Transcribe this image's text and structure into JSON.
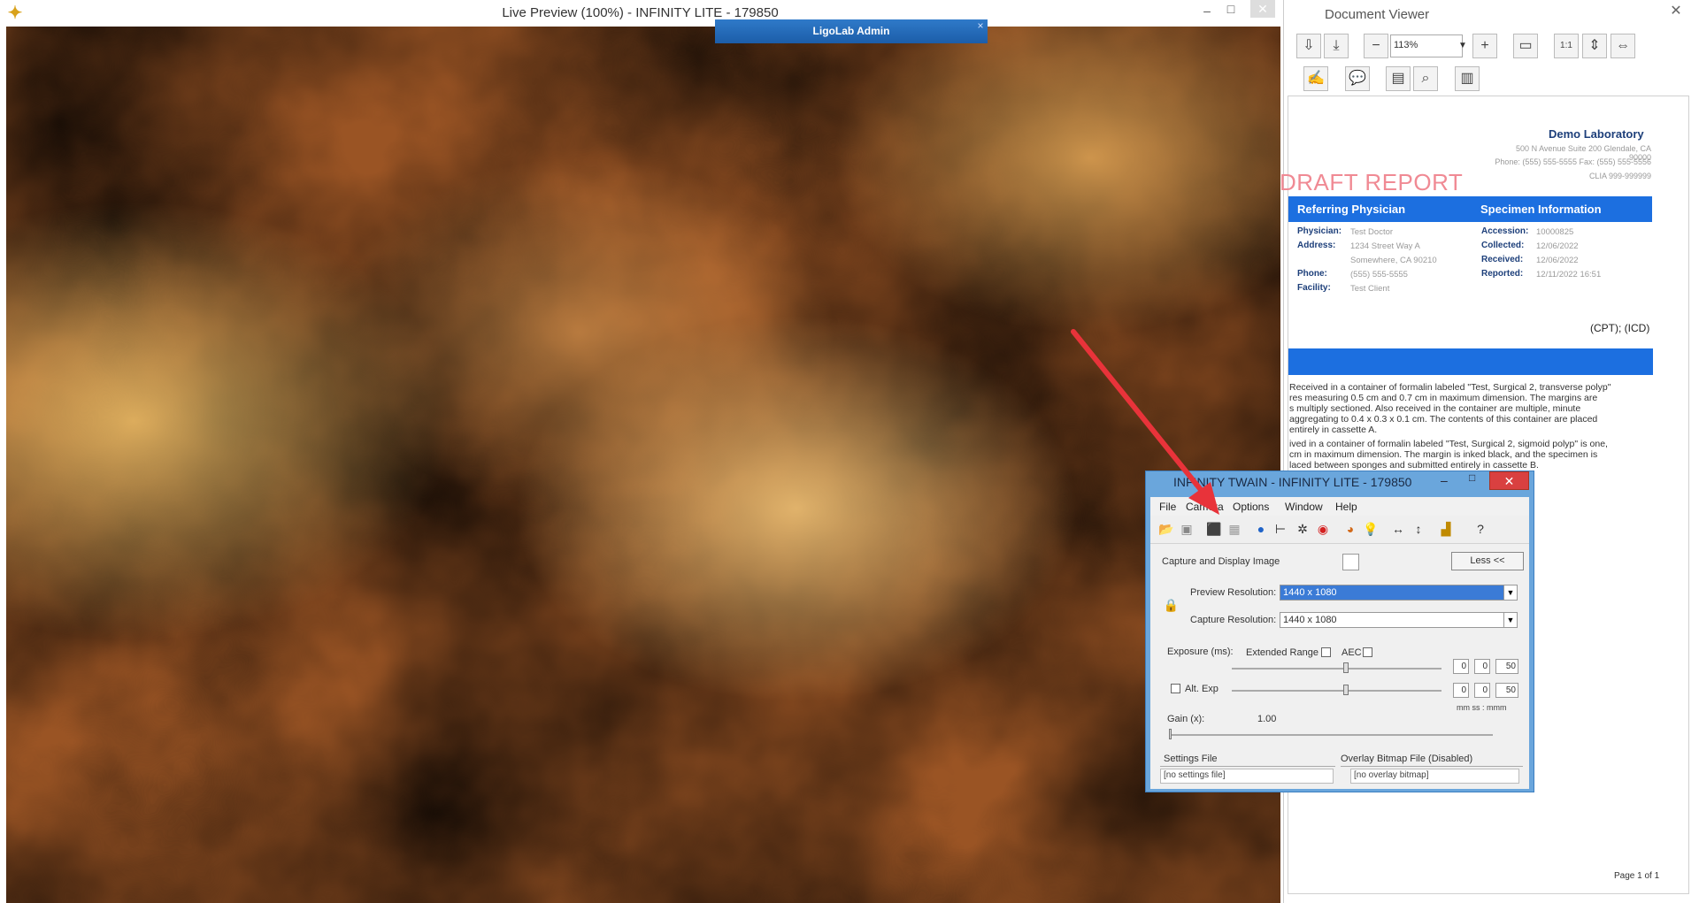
{
  "live_preview": {
    "title": "Live Preview (100%) - INFINITY LITE - 179850",
    "minimize": "–",
    "maximize": "□",
    "close": "✕",
    "app_icon": "✦",
    "banner_text": "LigoLab Admin",
    "banner_close": "×"
  },
  "doc_viewer": {
    "title": "Document Viewer",
    "close": "✕",
    "zoom": "113%",
    "lab_name": "Demo Laboratory",
    "lab_address": "500 N Avenue Suite 200  Glendale, CA 90000",
    "lab_phone": "Phone: (555) 555-5555   Fax: (555) 555-5556",
    "lab_clia": "CLIA 999-999999",
    "draft": "DRAFT REPORT",
    "referring_header": "Referring Physician",
    "specimen_header": "Specimen Information",
    "physician_k": "Physician:",
    "physician_v": "Test Doctor",
    "address_k": "Address:",
    "address_v1": "1234 Street Way A",
    "address_v2": "Somewhere, CA 90210",
    "phone_k": "Phone:",
    "phone_v": "(555) 555-5555",
    "facility_k": "Facility:",
    "facility_v": "Test Client",
    "accession_k": "Accession:",
    "accession_v": "10000825",
    "collected_k": "Collected:",
    "collected_v": "12/06/2022",
    "received_k": "Received:",
    "received_v": "12/06/2022",
    "reported_k": "Reported:",
    "reported_v": "12/11/2022 16:51",
    "cpt_icd": "(CPT); (ICD)",
    "para1": [
      "Received in a container of formalin labeled \"Test, Surgical 2, transverse polyp\"",
      "res measuring 0.5 cm and 0.7 cm in maximum dimension.  The margins are",
      "s multiply sectioned.  Also received in the container are multiple, minute",
      "aggregating to 0.4 x 0.3 x 0.1 cm.  The contents of this container are placed",
      "entirely in cassette A."
    ],
    "para2": [
      "ived in a container of formalin labeled \"Test, Surgical 2, sigmoid polyp\" is one,",
      "cm in maximum dimension.  The margin is inked black, and the specimen is",
      "laced between sponges and submitted entirely in cassette B."
    ],
    "page_of": "Page 1 of 1"
  },
  "twain": {
    "title": "INFINITY TWAIN - INFINITY LITE - 179850",
    "close": "✕",
    "menus": [
      "File",
      "Camera",
      "Options",
      "Window",
      "Help"
    ],
    "capture_display": "Capture and Display Image",
    "less_button": "Less <<",
    "preview_res_label": "Preview Resolution:",
    "preview_res_value": "1440 x 1080",
    "capture_res_label": "Capture Resolution:",
    "capture_res_value": "1440 x 1080",
    "exposure_label": "Exposure (ms):",
    "extended_range": "Extended Range",
    "aec": "AEC",
    "alt_exp": "Alt. Exp",
    "exp1": [
      "0",
      "0",
      "50"
    ],
    "exp2": [
      "0",
      "0",
      "50"
    ],
    "units": "mm  ss : mmm",
    "gain_label": "Gain (x):",
    "gain_value": "1.00",
    "settings_label": "Settings File",
    "overlay_label": "Overlay Bitmap File (Disabled)",
    "settings_value": "[no settings file]",
    "overlay_value": "[no overlay bitmap]"
  }
}
